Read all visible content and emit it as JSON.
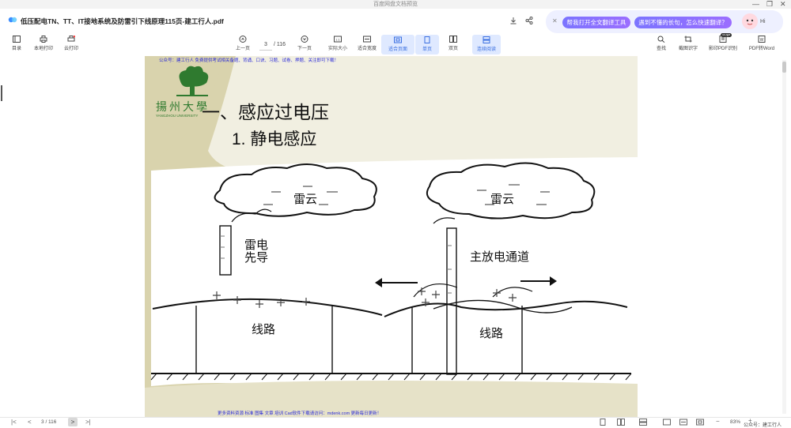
{
  "window": {
    "title": "百度网盘文档预览",
    "controls": [
      "—",
      "❐",
      "✕"
    ]
  },
  "file": {
    "name": "低压配电TN、TT、IT接地系统及防雷引下线原理115页-建工行人.pdf"
  },
  "translate": {
    "btn_full": "帮我打开全文翻译工具",
    "btn_sentence": "遇到不懂的长句，怎么快速翻译？",
    "avatar_text": "Hi"
  },
  "toolbar": {
    "left": [
      {
        "label": "目录",
        "icon": "toc-icon"
      },
      {
        "label": "本地打印",
        "icon": "printer-icon"
      },
      {
        "label": "云打印",
        "icon": "cloud-print-icon"
      }
    ],
    "prev_label": "上一页",
    "page_current": "3",
    "page_total": "/ 116",
    "next_label": "下一页",
    "center": [
      {
        "label": "实际大小",
        "icon": "actual-size-icon"
      },
      {
        "label": "适合宽度",
        "icon": "fit-width-icon"
      },
      {
        "label": "适合页面",
        "icon": "fit-page-icon"
      },
      {
        "label": "单页",
        "icon": "single-page-icon"
      },
      {
        "label": "双页",
        "icon": "double-page-icon"
      },
      {
        "label": "连续阅读",
        "icon": "continuous-icon"
      }
    ],
    "right": [
      {
        "label": "查找",
        "icon": "search-icon"
      },
      {
        "label": "截图识字",
        "icon": "screenshot-ocr-icon"
      },
      {
        "label": "影印PDF识别",
        "icon": "pdf-ocr-icon"
      },
      {
        "label": "PDF转Word",
        "icon": "pdf-word-icon"
      }
    ],
    "svip_badge": "SVIP"
  },
  "doc": {
    "top_note": "公众号：建工行人 免费提供考试相关备题、背诵、口诀、习题、试卷、押题、关注即可下载！",
    "logo_text": "揚州大學",
    "logo_sub": "YANGZHOU UNIVERSITY",
    "heading1": "一、感应过电压",
    "heading2": "1. 静电感应",
    "cloud_label_left": "雷云",
    "cloud_label_right": "雷云",
    "leader_label_1": "雷电",
    "leader_label_2": "先导",
    "main_channel_label": "主放电通道",
    "line_label_left": "线路",
    "line_label_right": "线路",
    "bottom_note": "更多资料资源 标准 图集 文章 培训 Cad软件下载请访问：mdenk.com 更新每日更新！"
  },
  "statusbar": {
    "page_current": "3",
    "page_total": "/ 116",
    "zoom": "83%",
    "watermark": "公众号：建工行人"
  },
  "colors": {
    "accent": "#5b8cff",
    "translate_pill": "#8a6dff",
    "notice_text": "#2a2ad8",
    "beige": "#d9d3ad",
    "logo_green": "#2f7a2f"
  }
}
